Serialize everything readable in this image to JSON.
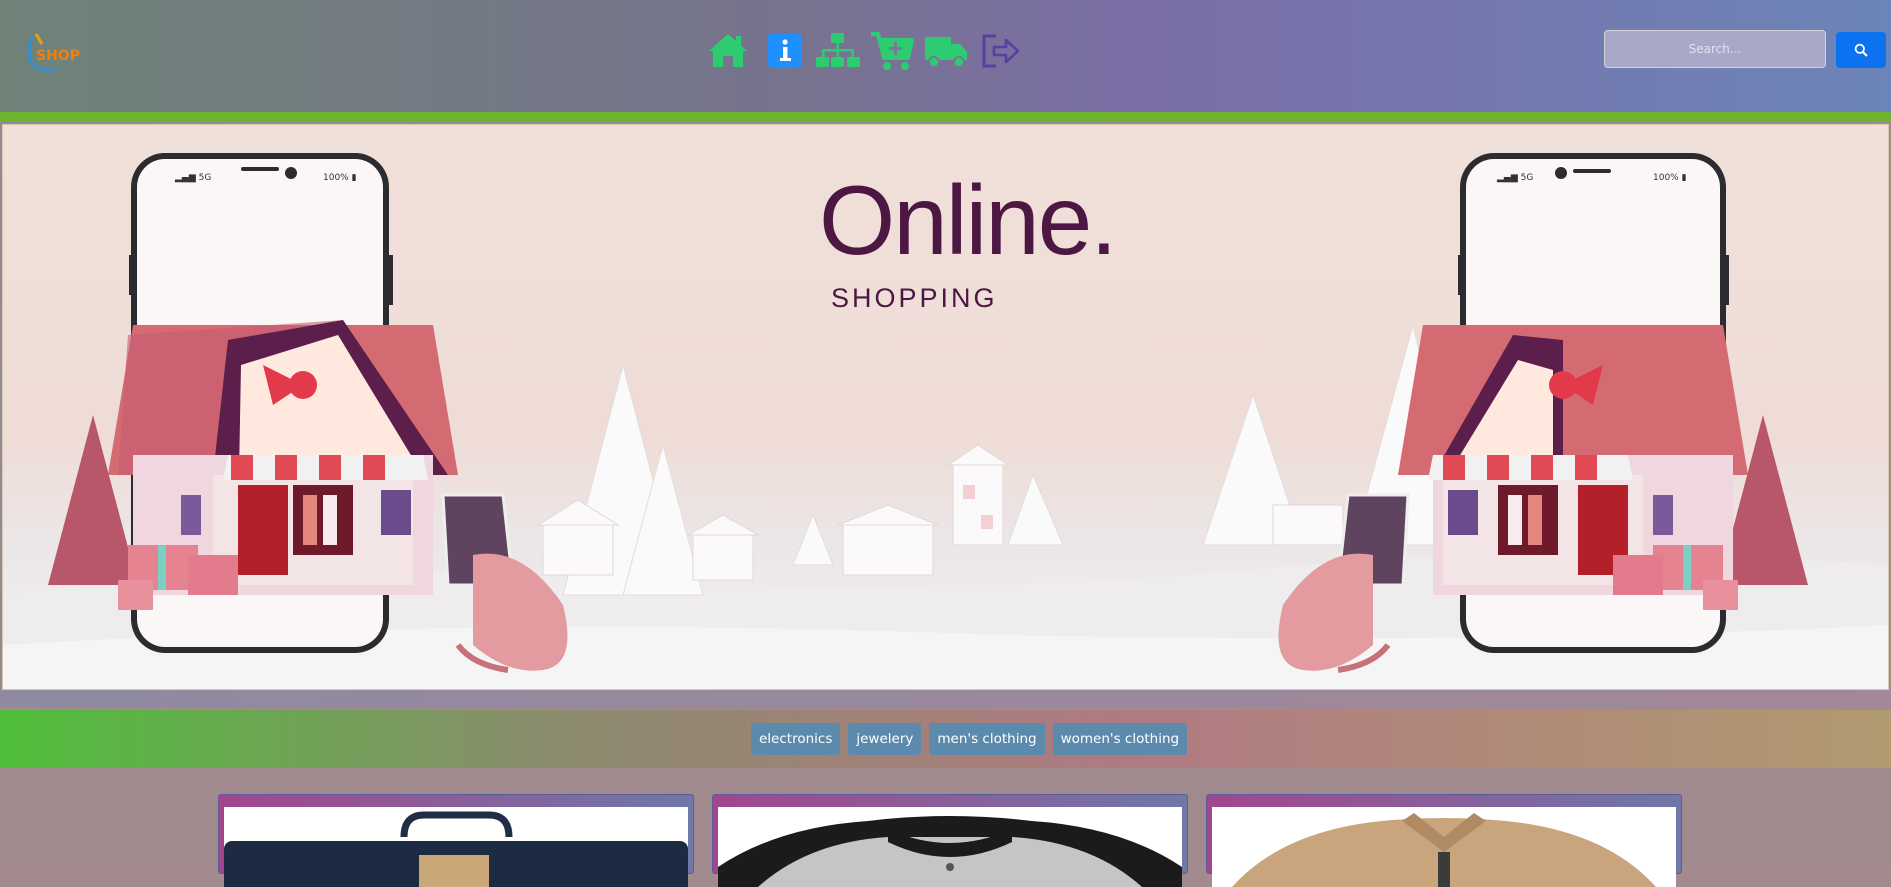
{
  "navbar": {
    "logo_text": "SHOP",
    "icons": [
      {
        "name": "home-icon",
        "color": "#2ecc71"
      },
      {
        "name": "info-icon",
        "color": "#1e90ff"
      },
      {
        "name": "sitemap-icon",
        "color": "#2ecc71"
      },
      {
        "name": "cart-plus-icon",
        "color": "#2ecc71"
      },
      {
        "name": "truck-icon",
        "color": "#2ecc71"
      },
      {
        "name": "logout-icon",
        "color": "#5b3fa0"
      }
    ],
    "search_placeholder": "Search...",
    "search_button_icon": "search-icon"
  },
  "banner": {
    "title": "Online.",
    "subtitle": "SHOPPING"
  },
  "categories": [
    "electronics",
    "jewelery",
    "men's clothing",
    "women's clothing"
  ],
  "products": [
    {
      "image": "navy laptop bag"
    },
    {
      "image": "grey and black raglan t-shirt"
    },
    {
      "image": "beige jacket"
    }
  ],
  "colors": {
    "accent_green": "#2ecc71",
    "search_button": "#0d72f0",
    "category_button": "#5b8aad",
    "banner_text": "#4d1744"
  }
}
